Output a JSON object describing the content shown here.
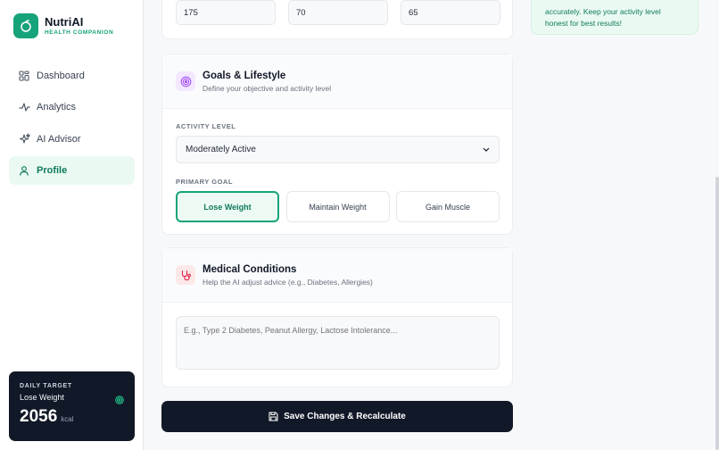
{
  "brand": {
    "name": "NutriAI",
    "subtitle": "HEALTH COMPANION",
    "accent": "#16a37a"
  },
  "nav": [
    {
      "label": "Dashboard",
      "icon": "grid-icon",
      "active": false
    },
    {
      "label": "Analytics",
      "icon": "activity-icon",
      "active": false
    },
    {
      "label": "AI Advisor",
      "icon": "sparkles-icon",
      "active": false
    },
    {
      "label": "Profile",
      "icon": "user-icon",
      "active": true
    }
  ],
  "daily_target": {
    "label": "DAILY TARGET",
    "goal": "Lose Weight",
    "value": "2056",
    "unit": "kcal"
  },
  "body_metrics": {
    "height": "175",
    "weight": "70",
    "target": "65"
  },
  "tip": {
    "text": "accurately. Keep your activity level honest for best results!"
  },
  "goals_section": {
    "title": "Goals & Lifestyle",
    "subtitle": "Define your objective and activity level",
    "activity_label": "ACTIVITY LEVEL",
    "activity_value": "Moderately Active",
    "goal_label": "PRIMARY GOAL",
    "goals": [
      "Lose Weight",
      "Maintain Weight",
      "Gain Muscle"
    ],
    "selected_goal": "Lose Weight"
  },
  "medical_section": {
    "title": "Medical Conditions",
    "subtitle": "Help the AI adjust advice (e.g., Diabetes, Allergies)",
    "placeholder": "E.g., Type 2 Diabetes, Peanut Allergy, Lactose Intolerance..."
  },
  "save_button": {
    "label": "Save Changes & Recalculate"
  }
}
